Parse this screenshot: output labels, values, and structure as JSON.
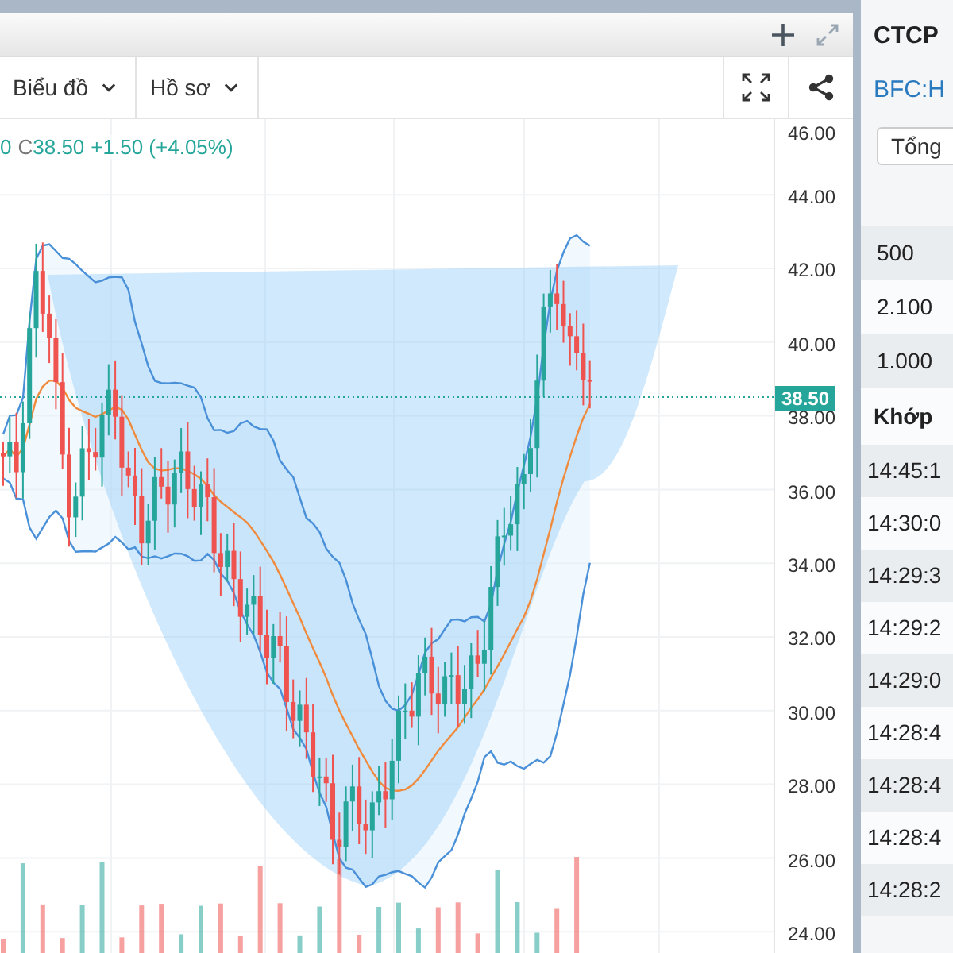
{
  "toolbar": {
    "menus": [
      {
        "label": "Biểu đồ"
      },
      {
        "label": "Hồ sơ"
      }
    ]
  },
  "chart": {
    "legend": {
      "cut_value": "0",
      "close_label": "C",
      "close": "38.50",
      "change": "+1.50 (+4.05%)"
    },
    "price_axis": [
      "46.00",
      "44.00",
      "42.00",
      "40.00",
      "38.00",
      "36.00",
      "34.00",
      "32.00",
      "30.00",
      "28.00",
      "26.00",
      "24.00"
    ],
    "last_price": "38.50"
  },
  "side_panel": {
    "title": "CTCP",
    "symbol": "BFC:H",
    "button": "Tổng",
    "volumes": [
      "500",
      "2.100",
      "1.000"
    ],
    "trades_heading": "Khớp",
    "trades": [
      "14:45:1",
      "14:30:0",
      "14:29:3",
      "14:29:2",
      "14:29:0",
      "14:28:4",
      "14:28:4",
      "14:28:4",
      "14:28:2"
    ]
  }
}
